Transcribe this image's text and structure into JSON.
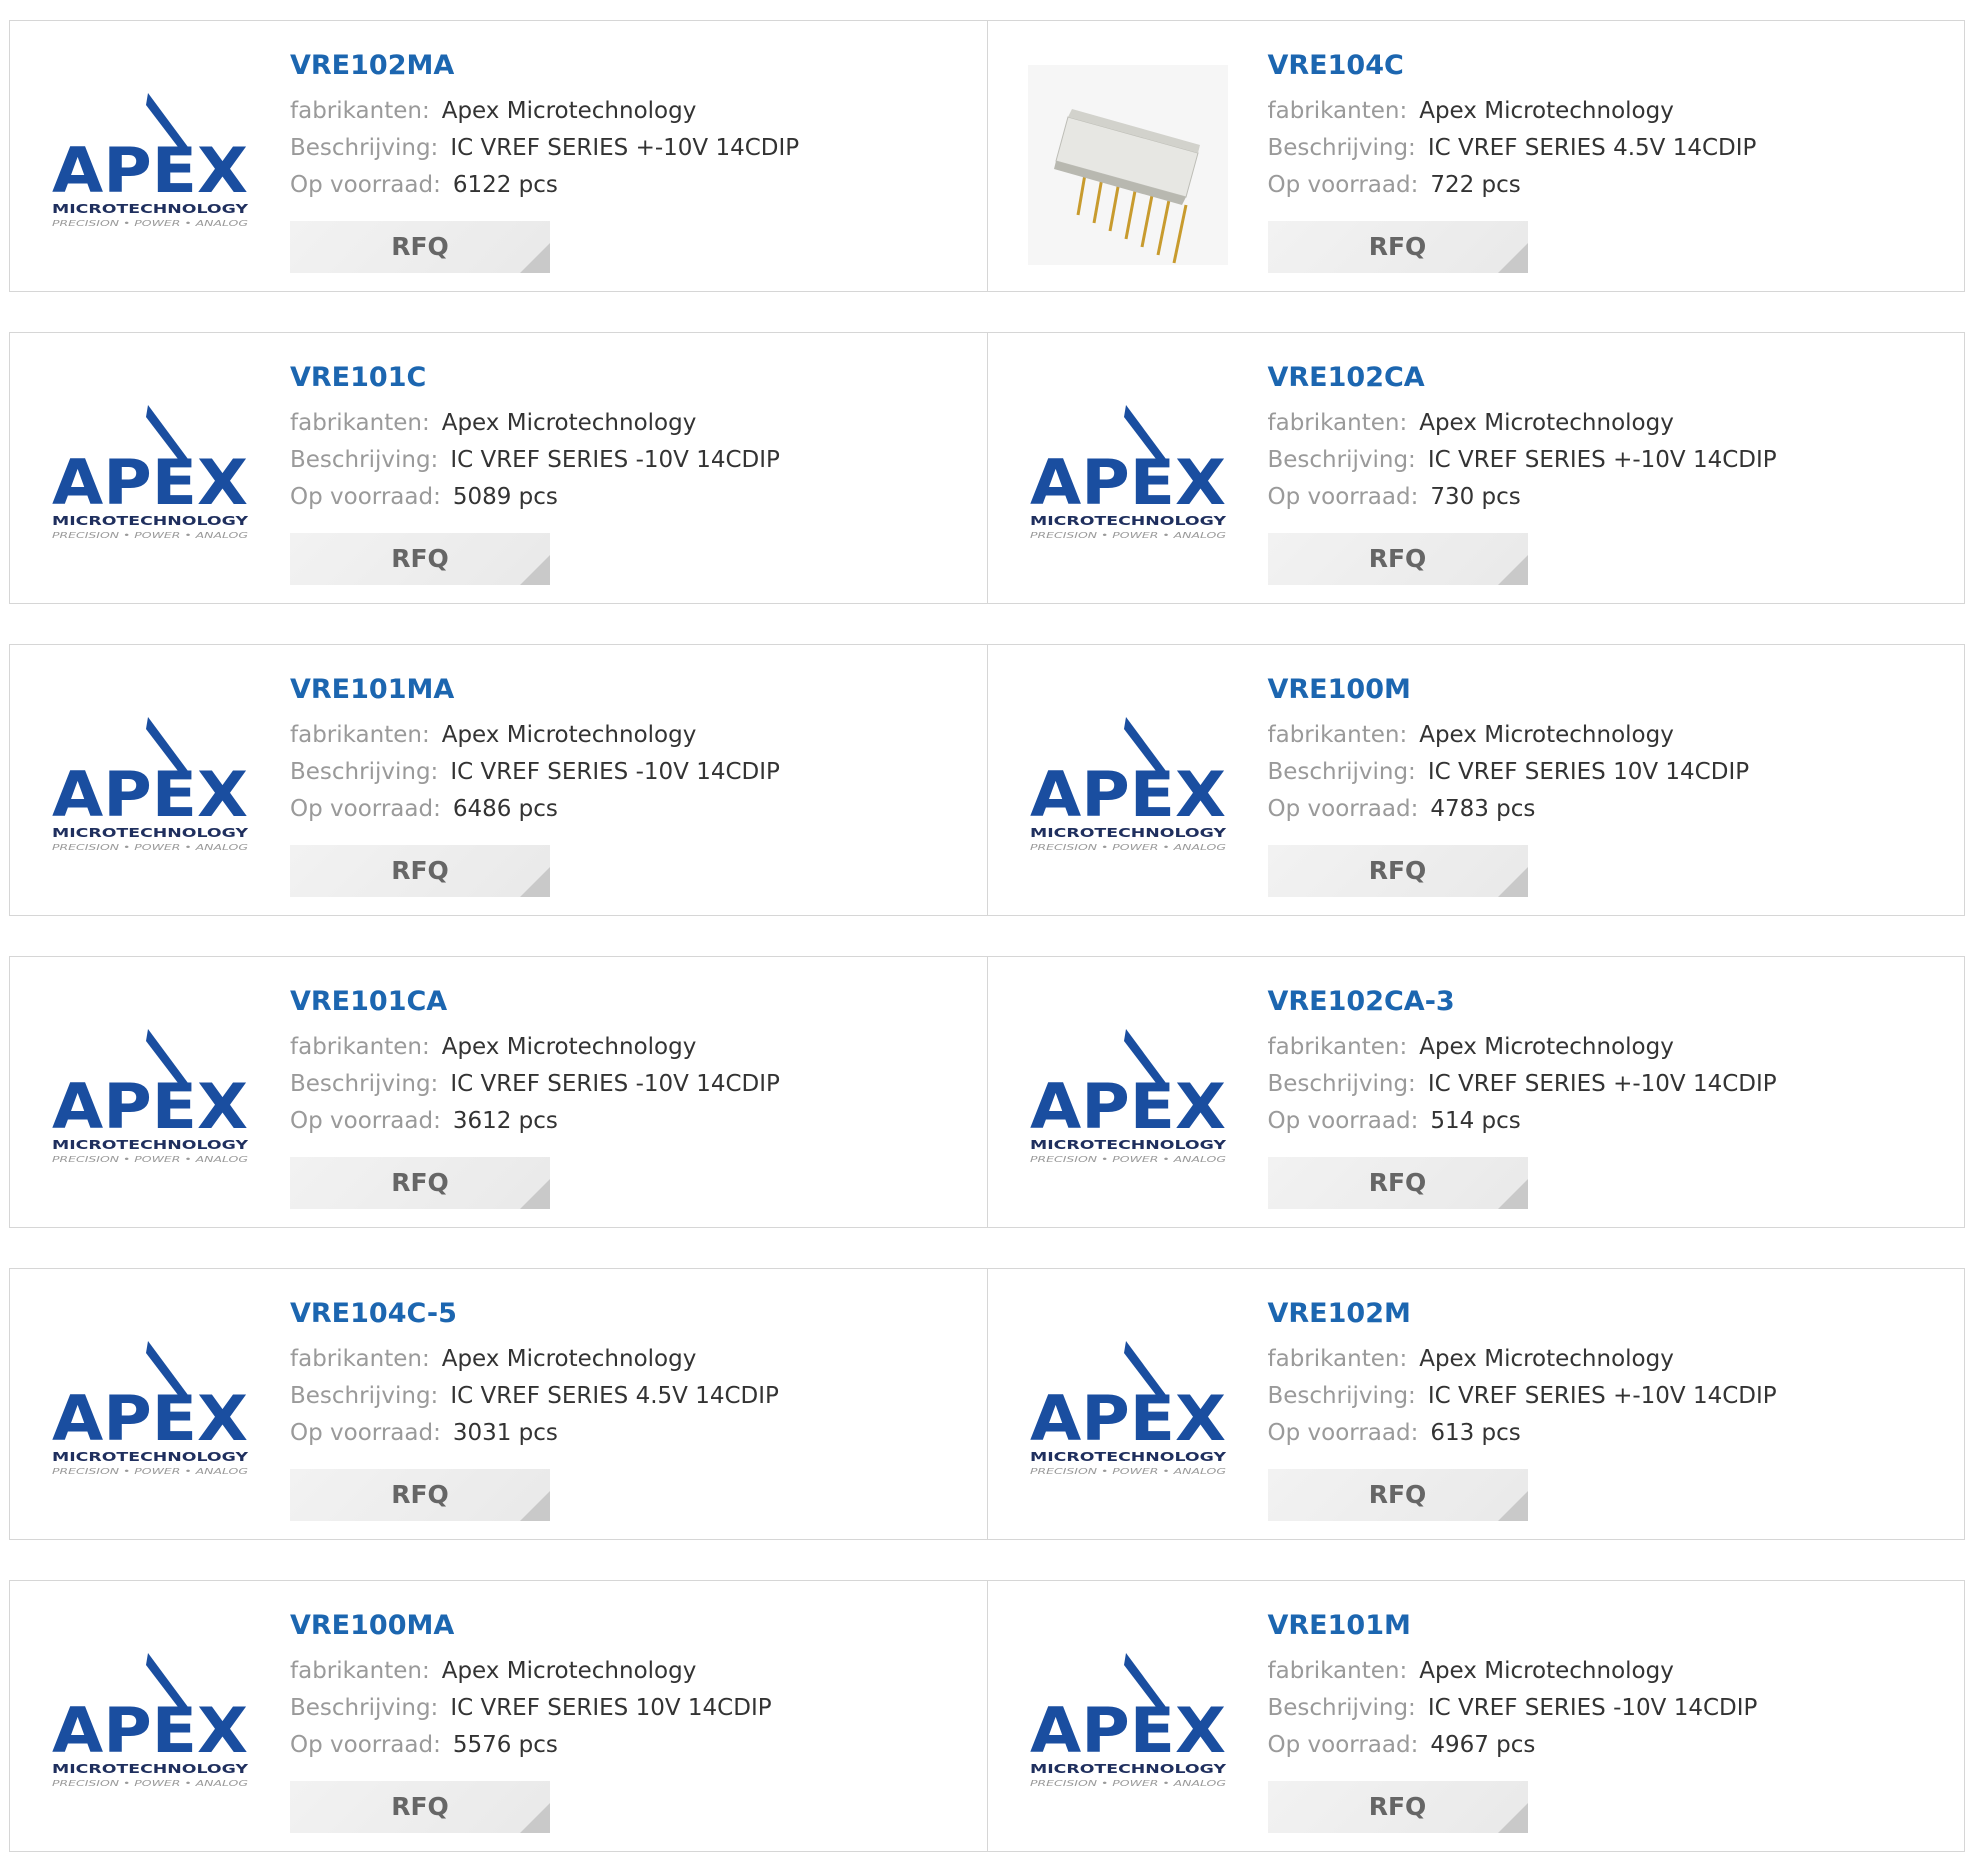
{
  "labels": {
    "manufacturer": "fabrikanten:",
    "description": "Beschrijving:",
    "stock": "Op voorraad:",
    "rfq": "RFQ"
  },
  "logo": {
    "wordmark": "APEX",
    "line1": "MICROTECHNOLOGY",
    "line2": "PRECISION • POWER • ANALOG",
    "color": "#1a4ea0"
  },
  "products": [
    {
      "part": "VRE102MA",
      "manufacturer": "Apex Microtechnology",
      "description": "IC VREF SERIES +-10V 14CDIP",
      "stock": "6122 pcs",
      "image": "apex-logo"
    },
    {
      "part": "VRE104C",
      "manufacturer": "Apex Microtechnology",
      "description": "IC VREF SERIES 4.5V 14CDIP",
      "stock": "722 pcs",
      "image": "chip-photo"
    },
    {
      "part": "VRE101C",
      "manufacturer": "Apex Microtechnology",
      "description": "IC VREF SERIES -10V 14CDIP",
      "stock": "5089 pcs",
      "image": "apex-logo"
    },
    {
      "part": "VRE102CA",
      "manufacturer": "Apex Microtechnology",
      "description": "IC VREF SERIES +-10V 14CDIP",
      "stock": "730 pcs",
      "image": "apex-logo"
    },
    {
      "part": "VRE101MA",
      "manufacturer": "Apex Microtechnology",
      "description": "IC VREF SERIES -10V 14CDIP",
      "stock": "6486 pcs",
      "image": "apex-logo"
    },
    {
      "part": "VRE100M",
      "manufacturer": "Apex Microtechnology",
      "description": "IC VREF SERIES 10V 14CDIP",
      "stock": "4783 pcs",
      "image": "apex-logo"
    },
    {
      "part": "VRE101CA",
      "manufacturer": "Apex Microtechnology",
      "description": "IC VREF SERIES -10V 14CDIP",
      "stock": "3612 pcs",
      "image": "apex-logo"
    },
    {
      "part": "VRE102CA-3",
      "manufacturer": "Apex Microtechnology",
      "description": "IC VREF SERIES +-10V 14CDIP",
      "stock": "514 pcs",
      "image": "apex-logo"
    },
    {
      "part": "VRE104C-5",
      "manufacturer": "Apex Microtechnology",
      "description": "IC VREF SERIES 4.5V 14CDIP",
      "stock": "3031 pcs",
      "image": "apex-logo"
    },
    {
      "part": "VRE102M",
      "manufacturer": "Apex Microtechnology",
      "description": "IC VREF SERIES +-10V 14CDIP",
      "stock": "613 pcs",
      "image": "apex-logo"
    },
    {
      "part": "VRE100MA",
      "manufacturer": "Apex Microtechnology",
      "description": "IC VREF SERIES 10V 14CDIP",
      "stock": "5576 pcs",
      "image": "apex-logo"
    },
    {
      "part": "VRE101M",
      "manufacturer": "Apex Microtechnology",
      "description": "IC VREF SERIES -10V 14CDIP",
      "stock": "4967 pcs",
      "image": "apex-logo"
    }
  ]
}
